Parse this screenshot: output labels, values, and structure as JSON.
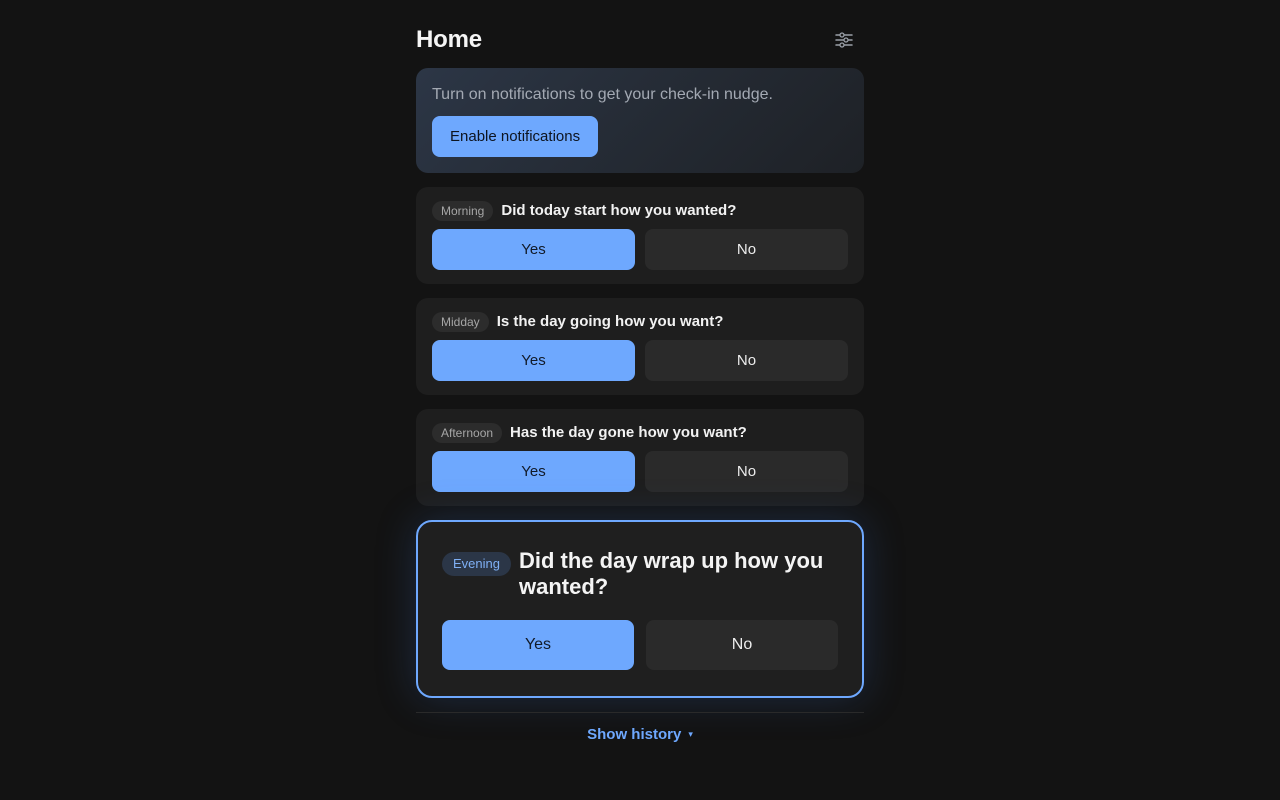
{
  "header": {
    "title": "Home",
    "settings_icon": "sliders-icon"
  },
  "notifications": {
    "message": "Turn on notifications to get your check-in nudge.",
    "button_label": "Enable notifications"
  },
  "checkins": [
    {
      "tag": "Morning",
      "question": "Did today start how you wanted?",
      "yes": "Yes",
      "no": "No"
    },
    {
      "tag": "Midday",
      "question": "Is the day going how you want?",
      "yes": "Yes",
      "no": "No"
    },
    {
      "tag": "Afternoon",
      "question": "Has the day gone how you want?",
      "yes": "Yes",
      "no": "No"
    },
    {
      "tag": "Evening",
      "question": "Did the day wrap up how you wanted?",
      "yes": "Yes",
      "no": "No"
    }
  ],
  "history": {
    "label": "Show history",
    "caret": "▾"
  },
  "colors": {
    "background": "#131313",
    "accent": "#6ea8fe",
    "card": "#1e1e1e"
  }
}
